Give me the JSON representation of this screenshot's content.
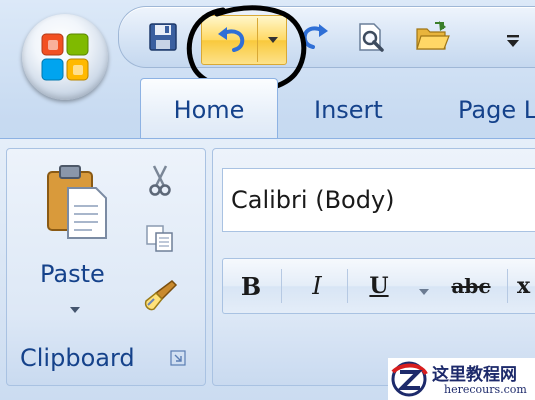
{
  "tabs": {
    "home": "Home",
    "insert": "Insert",
    "page_layout": "Page L"
  },
  "clipboard": {
    "paste_label": "Paste",
    "group_label": "Clipboard"
  },
  "font": {
    "font_name": "Calibri (Body)",
    "bold": "B",
    "italic": "I",
    "underline": "U",
    "strike": "abc",
    "next": "x"
  },
  "watermark": {
    "title": "这里教程网",
    "site": "herecours.com"
  },
  "colors": {
    "accent_text": "#15428b",
    "hover": "#ffd964",
    "annotation": "#000000"
  },
  "icons": {
    "office": "office-logo-icon",
    "save": "save-icon",
    "undo": "undo-icon",
    "redo": "redo-icon",
    "print_preview": "print-preview-icon",
    "open": "open-folder-icon",
    "customize": "customize-qat-icon",
    "paste": "paste-icon",
    "cut": "scissors-icon",
    "copy": "copy-icon",
    "format_painter": "format-painter-icon"
  }
}
